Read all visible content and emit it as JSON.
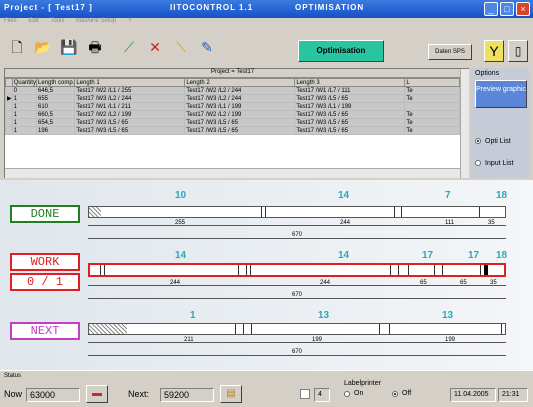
{
  "window": {
    "title": "Project - [ Test17 ]",
    "app": "IITOCONTROL 1.1",
    "mode": "OPTIMISATION"
  },
  "menu": [
    "Files",
    "Edit",
    "Tools",
    "Machine Setup",
    "?"
  ],
  "toolbar": {
    "optimisation": "Optimisation",
    "daten": "Daten SPS"
  },
  "grid": {
    "project": "Project = Test17",
    "columns": [
      "Quantity",
      "Length comp.",
      "Length 1",
      "Length 2",
      "Length 3",
      "L"
    ],
    "rows": [
      [
        "0",
        "646,5",
        "Test17 /W2 /L1 / 255",
        "Test17 /W2 /L2 / 244",
        "Test17 /W1 /L7 / 111",
        "Te"
      ],
      [
        "1",
        "655",
        "Test17 /W3 /L2 / 244",
        "Test17 /W3 /L2 / 244",
        "Test17 /W3 /L5 / 65",
        "Te"
      ],
      [
        "1",
        "610",
        "Test17 /W1 /L1 / 211",
        "Test17 /W3 /L1 / 199",
        "Test17 /W3 /L1 / 199",
        ""
      ],
      [
        "1",
        "660,5",
        "Test17 /W2 /L2 / 199",
        "Test17 /W2 /L2 / 199",
        "Test17 /W3 /L5 / 65",
        "Te"
      ],
      [
        "1",
        "654,5",
        "Test17 /W3 /L5 / 65",
        "Test17 /W3 /L5 / 65",
        "Test17 /W3 /L5 / 65",
        "Te"
      ],
      [
        "1",
        "196",
        "Test17 /W3 /L5 / 65",
        "Test17 /W3 /L5 / 65",
        "Test17 /W3 /L5 / 65",
        "Te"
      ]
    ]
  },
  "options": {
    "title": "Options",
    "preview": "Preview graphic",
    "opti_list": "Opti List",
    "input_list": "Input List"
  },
  "bars": {
    "done": {
      "label": "DONE",
      "nums": [
        "10",
        "14",
        "7",
        "18"
      ],
      "dims": [
        "255",
        "244",
        "111",
        "35"
      ],
      "total": "670"
    },
    "work": {
      "label": "WORK",
      "counter": "0 / 1",
      "nums": [
        "14",
        "14",
        "17",
        "17",
        "18"
      ],
      "dims": [
        "244",
        "244",
        "65",
        "65",
        "35"
      ],
      "total": "670"
    },
    "next": {
      "label": "NEXT",
      "nums": [
        "1",
        "13",
        "13"
      ],
      "dims": [
        "211",
        "199",
        "199"
      ],
      "total": "670"
    }
  },
  "status": {
    "title": "Status",
    "now_label": "Now",
    "now": "63000",
    "next_label": "Next:",
    "next": "59200",
    "count": "4",
    "labelprinter": "Labelprinter",
    "on": "On",
    "off": "Off",
    "date": "11.04.2005",
    "time": "21:31"
  },
  "colors": {
    "done": "#208020",
    "work": "#e02020",
    "next": "#c040c0",
    "numbers": "#28a8b8"
  }
}
